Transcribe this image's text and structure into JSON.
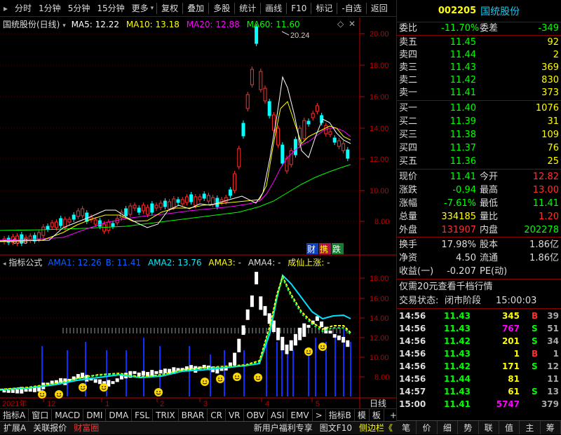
{
  "toolbar": {
    "items": [
      "分时",
      "1分钟",
      "5分钟",
      "15分钟",
      "更多",
      "复权",
      "叠加",
      "多股",
      "统计",
      "画线",
      "F10",
      "标记",
      "-自选",
      "返回"
    ]
  },
  "main_chart": {
    "title": "国统股份(日线)",
    "ma5_label": "MA5: 12.22",
    "ma10_label": "MA10: 13.18",
    "ma20_label": "MA20: 12.88",
    "ma60_label": "MA60: 11.60",
    "y_ticks": [
      "20.00",
      "18.00",
      "16.00",
      "14.00",
      "12.00",
      "10.00",
      "8.00"
    ],
    "high_label": "20.24",
    "low_label": "6.68",
    "badges": [
      "财",
      "携",
      "跌"
    ],
    "colors": {
      "ma5": "#ffffff",
      "ma10": "#ffff00",
      "ma20": "#ff00ff",
      "ma60": "#00ff00",
      "up": "#ff3030",
      "down": "#00ffff",
      "axis": "#c00000"
    }
  },
  "indicator": {
    "title": "指标公式",
    "ama1_label": "AMA1: 12.26",
    "b_label": "B: 11.41",
    "ama2_label": "AMA2: 13.76",
    "ama3_label": "AMA3: -",
    "ama4_label": "AMA4: -",
    "cx_label": "成仙上涨: -",
    "y_ticks": [
      "18.00",
      "16.00",
      "14.00",
      "12.00",
      "10.00",
      "8.00"
    ]
  },
  "time_axis": {
    "labels": [
      "2021年",
      "12",
      "1",
      "2",
      "3",
      "4",
      "5"
    ],
    "period": "日线"
  },
  "bottom_tabs": [
    "指标A",
    "窗口",
    "MACD",
    "DMI",
    "DMA",
    "FSL",
    "TRIX",
    "BRAR",
    "CR",
    "VR",
    "OBV",
    "ASI",
    "EMV",
    ">",
    "指标B",
    "模",
    "板",
    "+",
    "−"
  ],
  "status_bar": {
    "left": [
      "扩展A",
      "关联报价",
      "财富圈"
    ],
    "right": [
      "新用户福利专享",
      "图文F10",
      "侧边栏《"
    ]
  },
  "quote": {
    "code": "002205",
    "name": "国统股份",
    "weibi_label": "委比",
    "weibi": "-11.70%",
    "weicha_label": "委差",
    "weicha": "-349",
    "sells": [
      {
        "label": "卖五",
        "price": "11.45",
        "vol": "92"
      },
      {
        "label": "卖四",
        "price": "11.44",
        "vol": "2"
      },
      {
        "label": "卖三",
        "price": "11.43",
        "vol": "369"
      },
      {
        "label": "卖二",
        "price": "11.42",
        "vol": "830"
      },
      {
        "label": "卖一",
        "price": "11.41",
        "vol": "373"
      }
    ],
    "buys": [
      {
        "label": "买一",
        "price": "11.40",
        "vol": "1076"
      },
      {
        "label": "买二",
        "price": "11.39",
        "vol": "31"
      },
      {
        "label": "买三",
        "price": "11.38",
        "vol": "109"
      },
      {
        "label": "买四",
        "price": "11.37",
        "vol": "76"
      },
      {
        "label": "买五",
        "price": "11.36",
        "vol": "25"
      }
    ],
    "stats": [
      {
        "l1": "现价",
        "v1": "11.41",
        "l2": "今开",
        "v2": "12.82",
        "c1": "#00ff00",
        "c2": "#ff3030"
      },
      {
        "l1": "涨跌",
        "v1": "-0.94",
        "l2": "最高",
        "v2": "13.00",
        "c1": "#00ff00",
        "c2": "#ff3030"
      },
      {
        "l1": "涨幅",
        "v1": "-7.61%",
        "l2": "最低",
        "v2": "11.41",
        "c1": "#00ff00",
        "c2": "#00ff00"
      },
      {
        "l1": "总量",
        "v1": "334185",
        "l2": "量比",
        "v2": "1.20",
        "c1": "#ffff00",
        "c2": "#ff3030"
      },
      {
        "l1": "外盘",
        "v1": "131907",
        "l2": "内盘",
        "v2": "202278",
        "c1": "#ff3030",
        "c2": "#00ff00"
      }
    ],
    "stats2": [
      {
        "l1": "换手",
        "v1": "17.98%",
        "l2": "股本",
        "v2": "1.86亿"
      },
      {
        "l1": "净资",
        "v1": "4.50",
        "l2": "流通",
        "v2": "1.86亿"
      },
      {
        "l1": "收益(一)",
        "v1": "-0.207",
        "l2": "PE(动)",
        "v2": ""
      }
    ],
    "promo": "仅需20元查看千档行情",
    "trade_status_label": "交易状态:",
    "trade_status": "闭市阶段",
    "trade_time": "15:00:03",
    "ticks": [
      {
        "t": "14:56",
        "p": "11.43",
        "v": "345",
        "d": "B",
        "n": "39",
        "vc": "#ffff00",
        "dc": "#ff3030"
      },
      {
        "t": "14:56",
        "p": "11.43",
        "v": "767",
        "d": "S",
        "n": "51",
        "vc": "#ff00ff",
        "dc": "#00ff00"
      },
      {
        "t": "14:56",
        "p": "11.42",
        "v": "201",
        "d": "S",
        "n": "34",
        "vc": "#ffff00",
        "dc": "#00ff00"
      },
      {
        "t": "14:56",
        "p": "11.43",
        "v": "1",
        "d": "B",
        "n": "1",
        "vc": "#ffff00",
        "dc": "#ff3030"
      },
      {
        "t": "14:56",
        "p": "11.42",
        "v": "171",
        "d": "S",
        "n": "12",
        "vc": "#ffff00",
        "dc": "#00ff00"
      },
      {
        "t": "14:56",
        "p": "11.44",
        "v": "81",
        "d": "",
        "n": "11",
        "vc": "#ffff00",
        "dc": "#00ff00"
      },
      {
        "t": "14:57",
        "p": "11.43",
        "v": "61",
        "d": "S",
        "n": "13",
        "vc": "#ffff00",
        "dc": "#00ff00"
      },
      {
        "t": "15:00",
        "p": "11.41",
        "v": "5747",
        "d": "",
        "n": "379",
        "vc": "#ff00ff",
        "dc": "#00ff00"
      }
    ],
    "side_tabs": [
      "笔",
      "价",
      "细",
      "势",
      "联",
      "值",
      "主",
      "筹"
    ]
  }
}
